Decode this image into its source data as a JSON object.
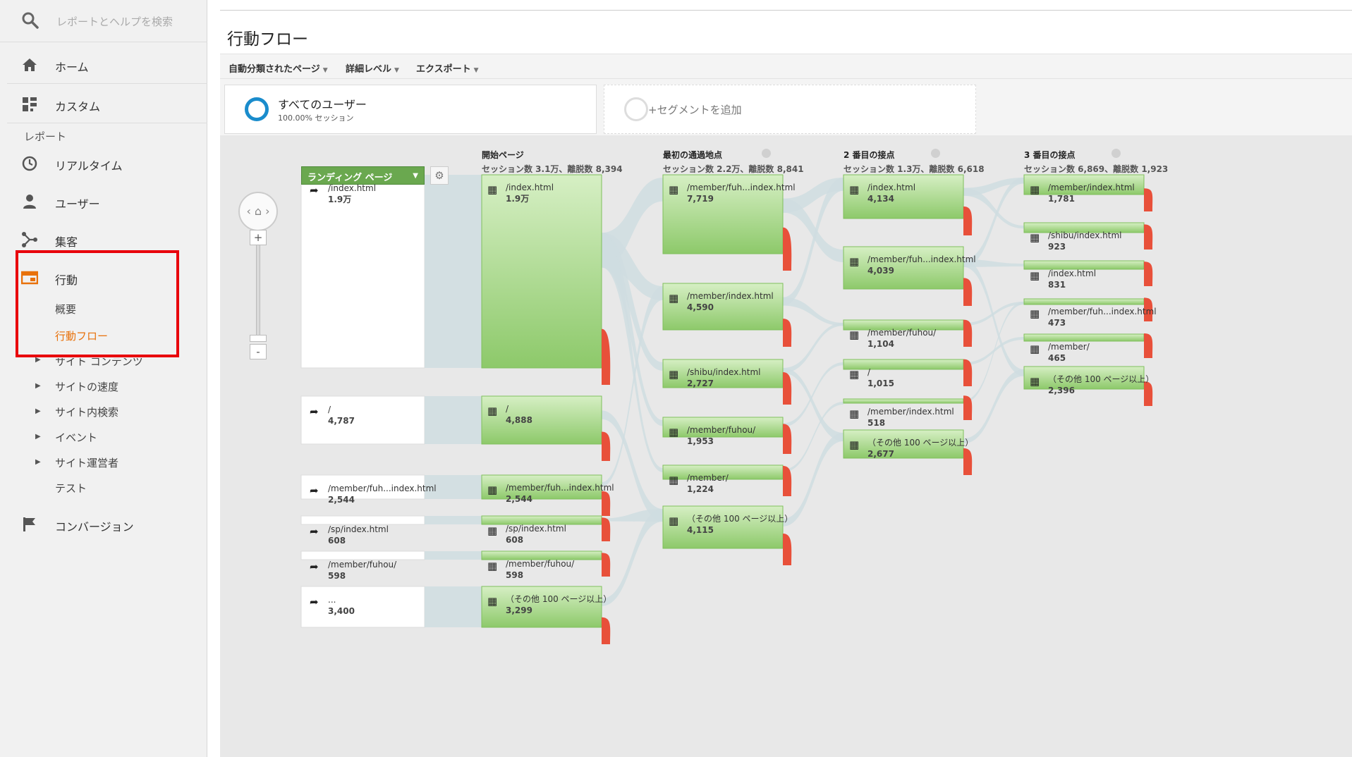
{
  "sidebar": {
    "search_placeholder": "レポートとヘルプを検索",
    "home": "ホーム",
    "custom": "カスタム",
    "reports_label": "レポート",
    "items": [
      {
        "label": "リアルタイム"
      },
      {
        "label": "ユーザー"
      },
      {
        "label": "集客"
      },
      {
        "label": "行動"
      }
    ],
    "behavior_sub": [
      "概要",
      "行動フロー"
    ],
    "behavior_expand": [
      "サイト コンテンツ",
      "サイトの速度",
      "サイト内検索",
      "イベント",
      "サイト運営者"
    ],
    "test": "テスト",
    "conversion": "コンバージョン",
    "accent_color": "#e8710a",
    "highlight_box_color": "#e8000b"
  },
  "header": {
    "title": "行動フロー",
    "toolbar": [
      "自動分類されたページ",
      "詳細レベル",
      "エクスポート"
    ]
  },
  "segments": {
    "all_users": "すべてのユーザー",
    "all_users_pct": "100.00% セッション",
    "add_segment": "+セグメントを追加"
  },
  "flow": {
    "dimension_select": "ランディング ページ",
    "zoom_in": "+",
    "zoom_out": "-",
    "node_color": "#8dc96a",
    "dropoff_color": "#e8503a",
    "columns": [
      {
        "title": "開始ページ",
        "stats": "セッション数 3.1万、離脱数 8,394",
        "nodes": [
          {
            "path": "/index.html",
            "count": "1.9万"
          },
          {
            "path": "/",
            "count": "4,888"
          },
          {
            "path": "/member/fuh...index.html",
            "count": "2,544"
          },
          {
            "path": "/sp/index.html",
            "count": "608"
          },
          {
            "path": "/member/fuhou/",
            "count": "598"
          },
          {
            "path": "（その他 100 ページ以上）",
            "count": "3,299"
          }
        ]
      },
      {
        "title": "最初の通過地点",
        "stats": "セッション数 2.2万、離脱数 8,841",
        "nodes": [
          {
            "path": "/member/fuh...index.html",
            "count": "7,719"
          },
          {
            "path": "/member/index.html",
            "count": "4,590"
          },
          {
            "path": "/shibu/index.html",
            "count": "2,727"
          },
          {
            "path": "/member/fuhou/",
            "count": "1,953"
          },
          {
            "path": "/member/",
            "count": "1,224"
          },
          {
            "path": "（その他 100 ページ以上）",
            "count": "4,115"
          }
        ]
      },
      {
        "title": "2 番目の接点",
        "stats": "セッション数 1.3万、離脱数 6,618",
        "nodes": [
          {
            "path": "/index.html",
            "count": "4,134"
          },
          {
            "path": "/member/fuh...index.html",
            "count": "4,039"
          },
          {
            "path": "/member/fuhou/",
            "count": "1,104"
          },
          {
            "path": "/",
            "count": "1,015"
          },
          {
            "path": "/member/index.html",
            "count": "518"
          },
          {
            "path": "（その他 100 ページ以上）",
            "count": "2,677"
          }
        ]
      },
      {
        "title": "3 番目の接点",
        "stats": "セッション数 6,869、離脱数 1,923",
        "nodes": [
          {
            "path": "/member/index.html",
            "count": "1,781"
          },
          {
            "path": "/shibu/index.html",
            "count": "923"
          },
          {
            "path": "/index.html",
            "count": "831"
          },
          {
            "path": "/member/fuh...index.html",
            "count": "473"
          },
          {
            "path": "/member/",
            "count": "465"
          },
          {
            "path": "（その他 100 ページ以上）",
            "count": "2,396"
          }
        ]
      }
    ],
    "landing": [
      {
        "path": "/index.html",
        "count": "1.9万"
      },
      {
        "path": "/",
        "count": "4,787"
      },
      {
        "path": "/member/fuh...index.html",
        "count": "2,544"
      },
      {
        "path": "/sp/index.html",
        "count": "608"
      },
      {
        "path": "/member/fuhou/",
        "count": "598"
      },
      {
        "path": "...",
        "count": "3,400"
      }
    ]
  }
}
